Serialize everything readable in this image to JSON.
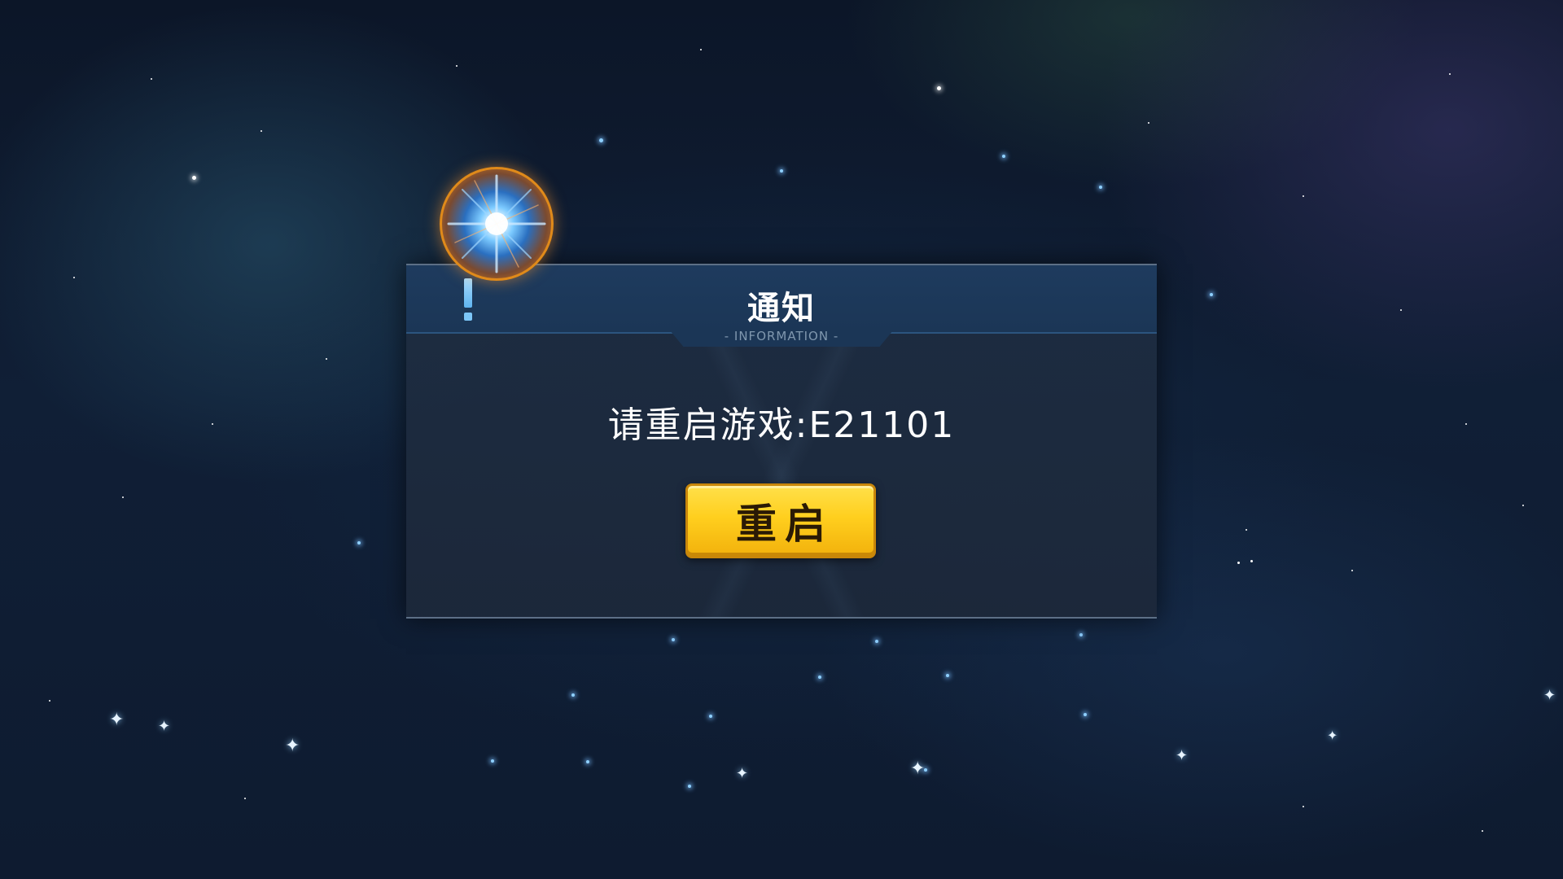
{
  "dialog": {
    "title": "通知",
    "subtitle": "- INFORMATION -",
    "message": "请重启游戏:E21101",
    "button_label": "重启"
  },
  "icons": {
    "alert": "exclamation-icon",
    "emblem": "starburst-emblem-icon"
  },
  "colors": {
    "button": "#ffcf1e",
    "header": "#1e3b5e",
    "panel": "#1e2d42",
    "emblem_ring": "#e08a1a"
  }
}
